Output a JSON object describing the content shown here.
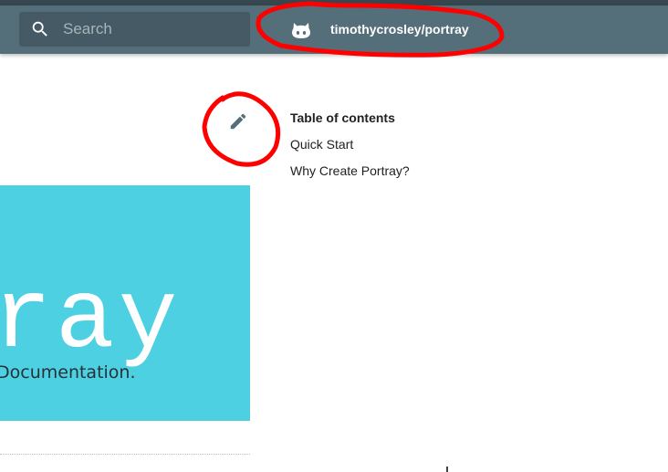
{
  "header": {
    "search": {
      "placeholder": "Search",
      "value": ""
    },
    "repo": {
      "name": "timothycrosley/portray",
      "icon": "github-icon"
    }
  },
  "content": {
    "edit_icon": "pencil-icon",
    "toc": {
      "title": "Table of contents",
      "items": [
        "Quick Start",
        "Why Create Portray?"
      ]
    },
    "logo": {
      "text": "ray",
      "tagline": "Documentation."
    }
  },
  "colors": {
    "header": "#546e7a",
    "search_box": "#455a64",
    "banner": "#4dd0e1",
    "annotation": "#ff0000"
  }
}
